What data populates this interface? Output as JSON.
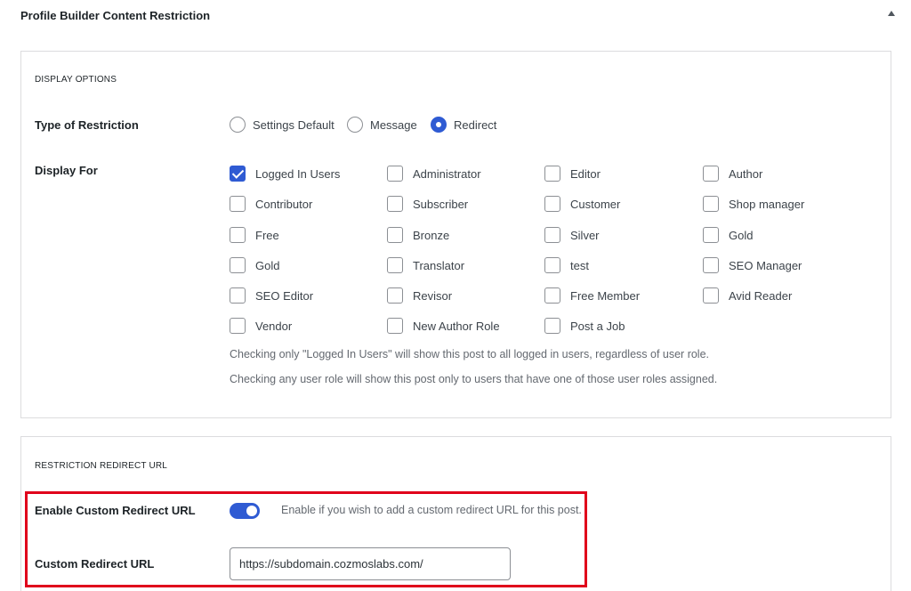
{
  "metabox": {
    "title": "Profile Builder Content Restriction"
  },
  "display_options": {
    "section_title": "DISPLAY OPTIONS",
    "type_label": "Type of Restriction",
    "restriction_types": [
      {
        "label": "Settings Default",
        "selected": false
      },
      {
        "label": "Message",
        "selected": false
      },
      {
        "label": "Redirect",
        "selected": true
      }
    ],
    "display_for_label": "Display For",
    "roles": [
      {
        "label": "Logged In Users",
        "checked": true
      },
      {
        "label": "Administrator",
        "checked": false
      },
      {
        "label": "Editor",
        "checked": false
      },
      {
        "label": "Author",
        "checked": false
      },
      {
        "label": "Contributor",
        "checked": false
      },
      {
        "label": "Subscriber",
        "checked": false
      },
      {
        "label": "Customer",
        "checked": false
      },
      {
        "label": "Shop manager",
        "checked": false
      },
      {
        "label": "Free",
        "checked": false
      },
      {
        "label": "Bronze",
        "checked": false
      },
      {
        "label": "Silver",
        "checked": false
      },
      {
        "label": "Gold",
        "checked": false
      },
      {
        "label": "Gold",
        "checked": false
      },
      {
        "label": "Translator",
        "checked": false
      },
      {
        "label": "test",
        "checked": false
      },
      {
        "label": "SEO Manager",
        "checked": false
      },
      {
        "label": "SEO Editor",
        "checked": false
      },
      {
        "label": "Revisor",
        "checked": false
      },
      {
        "label": "Free Member",
        "checked": false
      },
      {
        "label": "Avid Reader",
        "checked": false
      },
      {
        "label": "Vendor",
        "checked": false
      },
      {
        "label": "New Author Role",
        "checked": false
      },
      {
        "label": "Post a Job",
        "checked": false
      }
    ],
    "help_1": "Checking only \"Logged In Users\" will show this post to all logged in users, regardless of user role.",
    "help_2": "Checking any user role will show this post only to users that have one of those user roles assigned."
  },
  "redirect": {
    "section_title": "RESTRICTION REDIRECT URL",
    "enable_label": "Enable Custom Redirect URL",
    "enable_on": true,
    "enable_help": "Enable if you wish to add a custom redirect URL for this post.",
    "url_label": "Custom Redirect URL",
    "url_value": "https://subdomain.cozmoslabs.com/"
  },
  "colors": {
    "accent": "#2f5bd3",
    "highlight_border": "#e0001b"
  }
}
